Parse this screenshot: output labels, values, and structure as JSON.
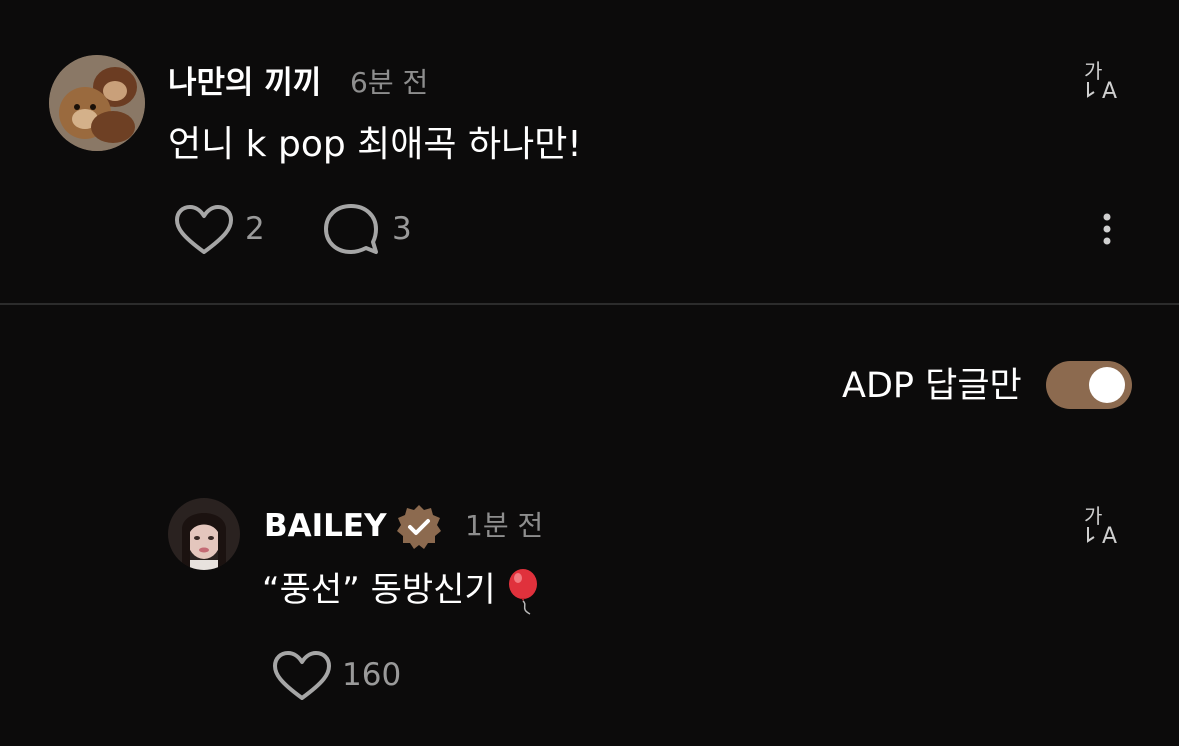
{
  "comment": {
    "username": "나만의 끼끼",
    "time": "6분 전",
    "text": "언니 k pop 최애곡 하나만!",
    "likes": "2",
    "replies": "3",
    "icons": {
      "translate": "translate-icon",
      "like": "heart-icon",
      "reply": "speech-bubble-icon",
      "more": "more-vertical-icon"
    }
  },
  "filter": {
    "label": "ADP 답글만",
    "toggle_on": true,
    "accent_color": "#8c6a4f"
  },
  "reply": {
    "username": "BAILEY",
    "verified": true,
    "time": "1분 전",
    "text": "“풍선” 동방신기",
    "likes": "160",
    "icons": {
      "verified": "verified-badge-icon",
      "translate": "translate-icon",
      "emoji": "balloon-emoji",
      "like": "heart-icon"
    }
  }
}
